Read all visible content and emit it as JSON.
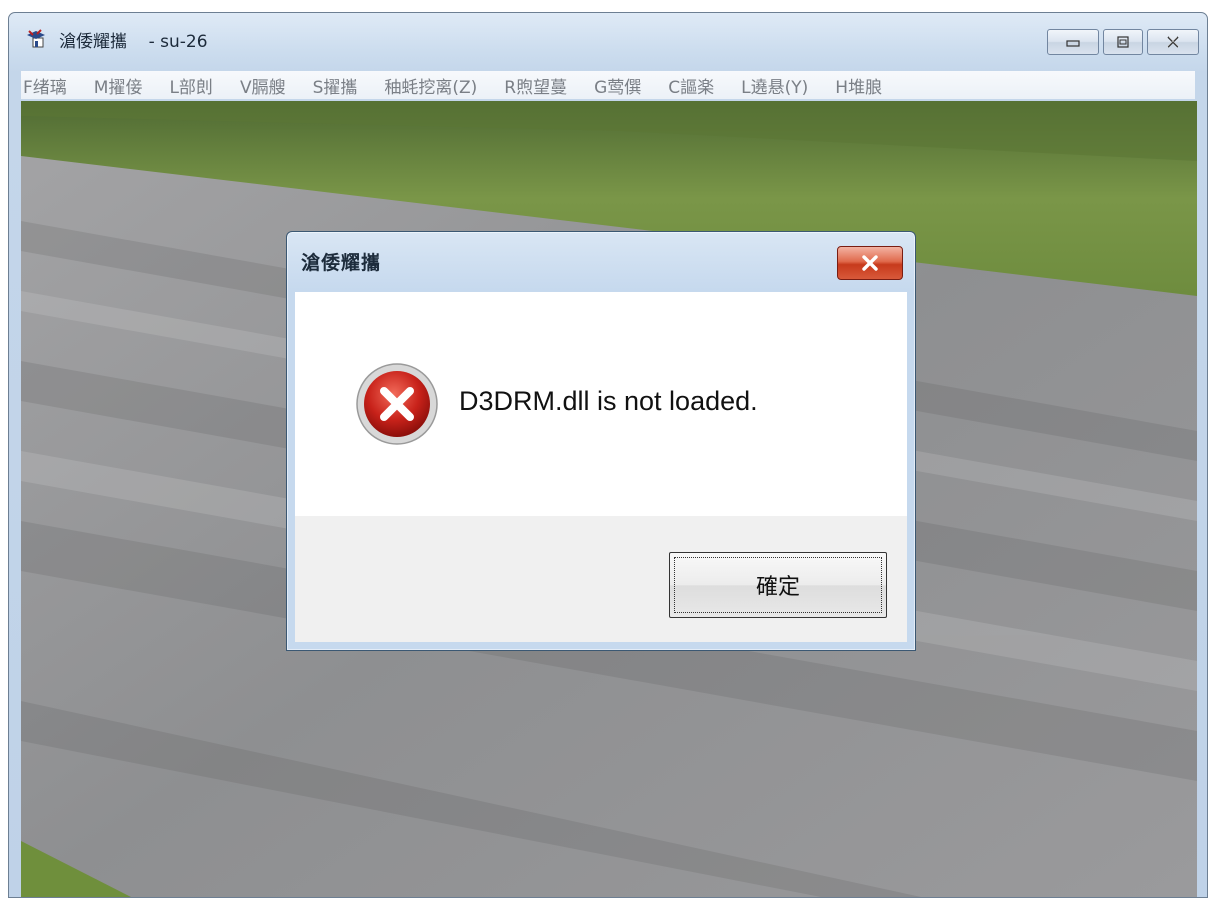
{
  "window": {
    "title": "滄倭耀攜",
    "subtitle": "- su-26"
  },
  "menu": [
    "F绪璃",
    "M擢倿",
    "L部剆",
    "V膈艘",
    "S擢攜",
    "秞蚝挖离(Z)",
    "R煦望蔓",
    "G莺僎",
    "C謳楽",
    "L遶悬(Y)",
    "H堆朖"
  ],
  "dialog": {
    "title": "滄倭耀攜",
    "message": "D3DRM.dll is not loaded.",
    "ok_label": "確定",
    "icon": "error-icon"
  },
  "colors": {
    "grass": "#6f8f3c",
    "tarmac": "#8d8e90",
    "close_red": "#c73a1c"
  }
}
